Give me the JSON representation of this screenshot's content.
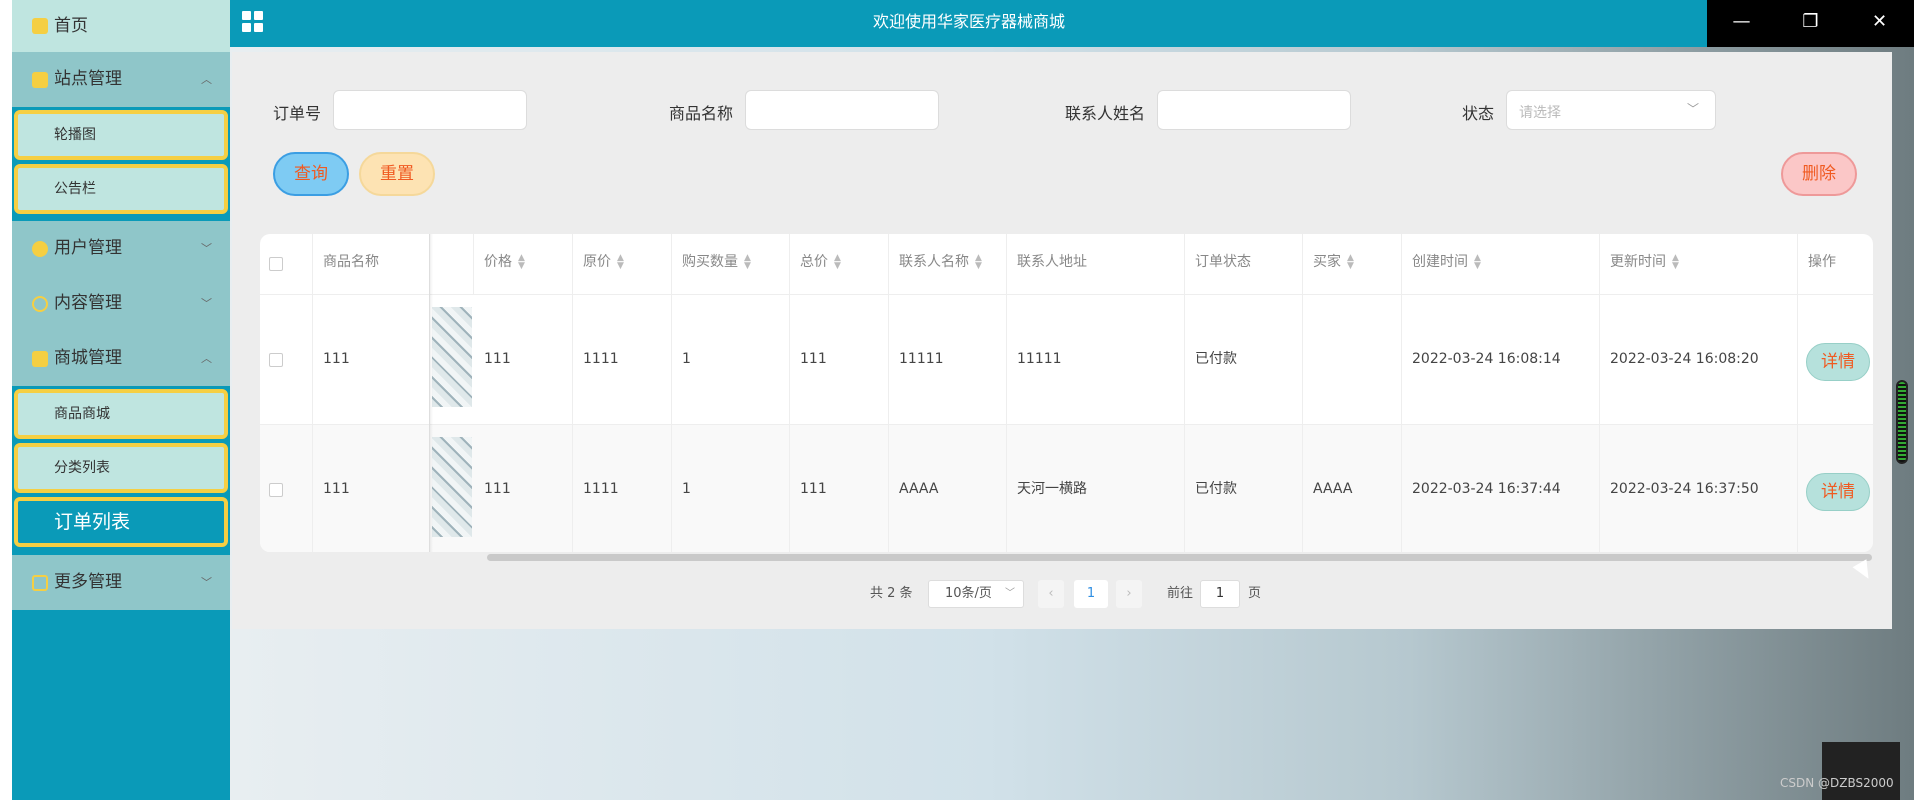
{
  "app": {
    "title": "欢迎使用华家医疗器械商城"
  },
  "window_controls": {
    "minimize": "—",
    "restore": "❐",
    "close": "✕"
  },
  "sidebar": {
    "home": "首页",
    "site_mgmt": "站点管理",
    "carousel": "轮播图",
    "notice": "公告栏",
    "user_mgmt": "用户管理",
    "content_mgmt": "内容管理",
    "mall_mgmt": "商城管理",
    "product_mall": "商品商城",
    "category_list": "分类列表",
    "order_list": "订单列表",
    "more_mgmt": "更多管理",
    "colors": {
      "bg": "#0a9ab8",
      "item": "#8fc6c9",
      "sub": "#bfe5e0",
      "sub_border": "#f5cf43"
    }
  },
  "search": {
    "order_no_label": "订单号",
    "product_name_label": "商品名称",
    "contact_name_label": "联系人姓名",
    "status_label": "状态",
    "status_placeholder": "请选择",
    "query_btn": "查询",
    "reset_btn": "重置",
    "delete_btn": "删除"
  },
  "table": {
    "headers": {
      "product_name": "商品名称",
      "price": "价格",
      "original_price": "原价",
      "quantity": "购买数量",
      "total": "总价",
      "contact_name": "联系人名称",
      "contact_address": "联系人地址",
      "order_status": "订单状态",
      "buyer": "买家",
      "created": "创建时间",
      "updated": "更新时间",
      "action": "操作"
    },
    "rows": [
      {
        "product_name": "111",
        "price": "111",
        "original_price": "1111",
        "quantity": "1",
        "total": "111",
        "contact_name": "11111",
        "contact_address": "11111",
        "order_status": "已付款",
        "buyer": "",
        "created": "2022-03-24 16:08:14",
        "updated": "2022-03-24 16:08:20",
        "action": "详情"
      },
      {
        "product_name": "111",
        "price": "111",
        "original_price": "1111",
        "quantity": "1",
        "total": "111",
        "contact_name": "AAAA",
        "contact_address": "天河一横路",
        "order_status": "已付款",
        "buyer": "AAAA",
        "created": "2022-03-24 16:37:44",
        "updated": "2022-03-24 16:37:50",
        "action": "详情"
      }
    ]
  },
  "pagination": {
    "total": "共 2 条",
    "page_size": "10条/页",
    "current_page": "1",
    "goto_label": "前往",
    "goto_value": "1",
    "page_unit": "页"
  },
  "watermark": "CSDN @DZBS2000"
}
